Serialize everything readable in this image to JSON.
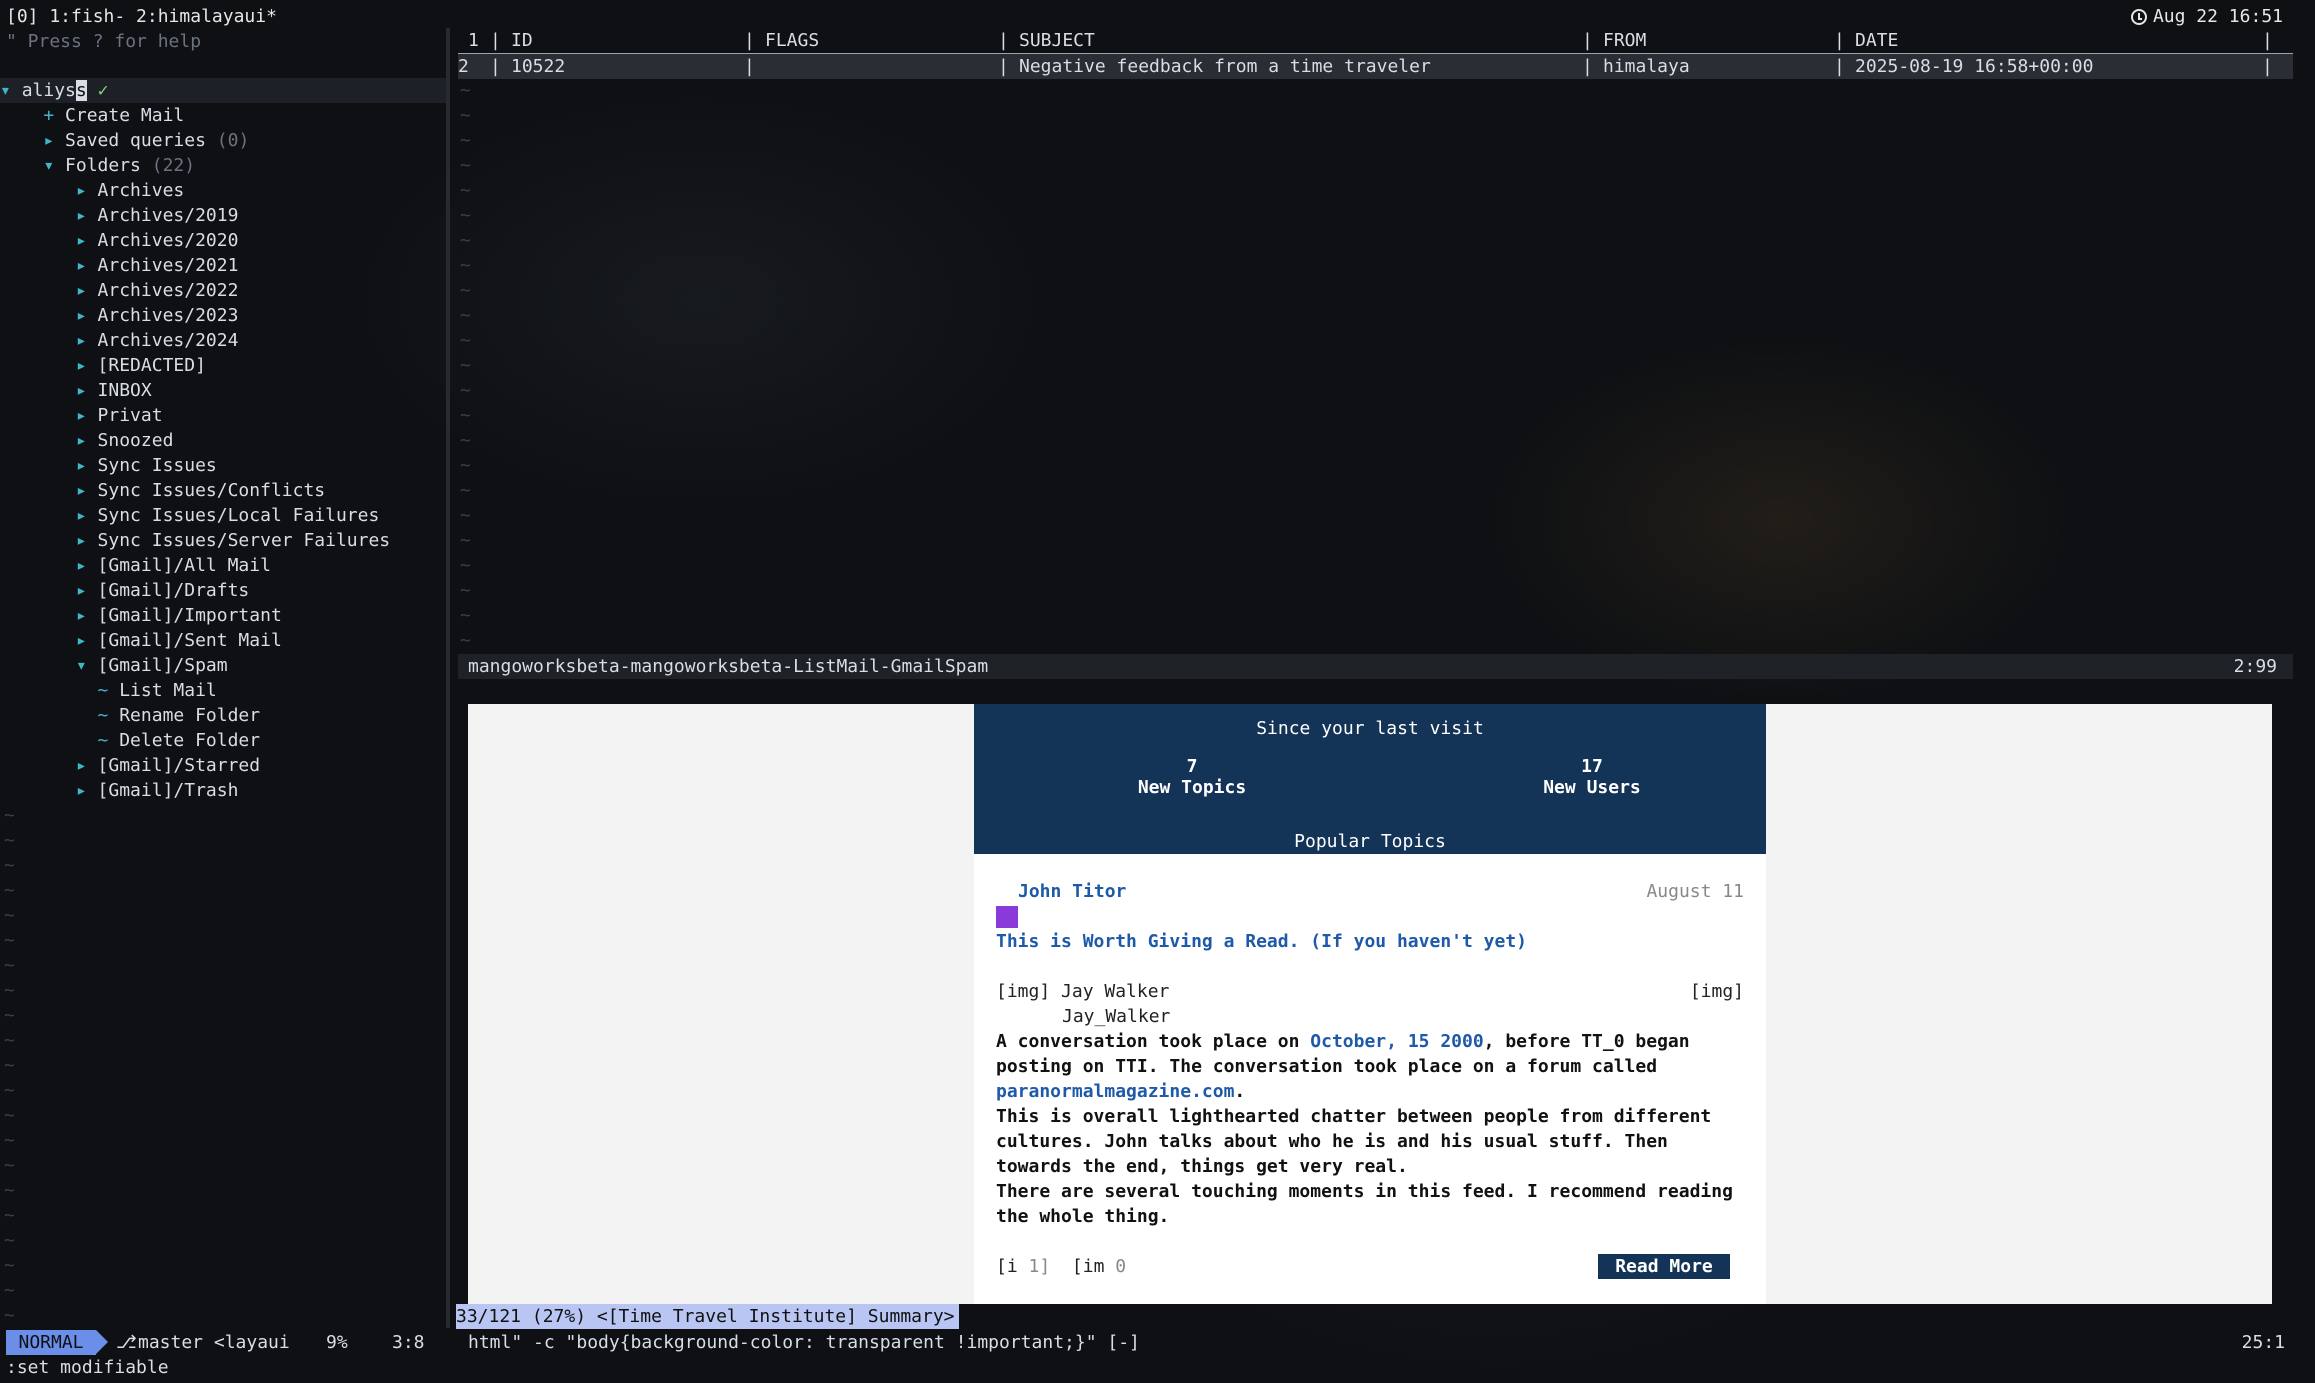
{
  "tmux": {
    "windows": "[0] 1:fish- 2:himalayaui*",
    "clock": "Aug 22 16:51",
    "clock_icon": "clock-icon"
  },
  "help_hint": "\" Press ? for help",
  "tree": {
    "account": "aliyss",
    "account_check": "✓",
    "create_mail": "Create Mail",
    "saved_queries": "Saved queries",
    "saved_queries_count": "(0)",
    "folders": "Folders",
    "folders_count": "(22)",
    "folder_items": [
      "Archives",
      "Archives/2019",
      "Archives/2020",
      "Archives/2021",
      "Archives/2022",
      "Archives/2023",
      "Archives/2024",
      "[REDACTED]",
      "INBOX",
      "Privat",
      "Snoozed",
      "Sync Issues",
      "Sync Issues/Conflicts",
      "Sync Issues/Local Failures",
      "Sync Issues/Server Failures",
      "[Gmail]/All Mail",
      "[Gmail]/Drafts",
      "[Gmail]/Important",
      "[Gmail]/Sent Mail",
      "[Gmail]/Spam"
    ],
    "spam_actions": [
      "List Mail",
      "Rename Folder",
      "Delete Folder"
    ],
    "after_items": [
      "[Gmail]/Starred",
      "[Gmail]/Trash"
    ]
  },
  "mail_list": {
    "header": {
      "line": "1",
      "id": "ID",
      "flags": "FLAGS",
      "subject": "SUBJECT",
      "from": "FROM",
      "date": "DATE"
    },
    "rows": [
      {
        "line": "2",
        "id": "10522",
        "flags": "",
        "subject": "Negative feedback from a time traveler",
        "from": "himalaya",
        "date": "2025-08-19 16:58+00:00"
      }
    ]
  },
  "buffer_bar": {
    "title": "mangoworksbeta-mangoworksbeta-ListMail-GmailSpam",
    "position": "2:99"
  },
  "preview": {
    "hero_title": "Since your last visit",
    "stats": [
      {
        "num": "7",
        "label": "New Topics"
      },
      {
        "num": "17",
        "label": "New Users"
      }
    ],
    "popular": "Popular Topics",
    "author": "John Titor",
    "date": "August 11",
    "post_title": "This is Worth Giving a Read. (If you haven't yet)",
    "img_left": "[img] Jay Walker",
    "img_right": "[img]",
    "username": "Jay_Walker",
    "p1_a": "A conversation took place on ",
    "p1_link": "October, 15 2000",
    "p1_b": ", before TT_0 began",
    "p2": "posting on TTI. The conversation took place on a forum called",
    "p3_link": "paranormalmagazine.com",
    "p3_b": ".",
    "p4": "This is overall lighthearted chatter between people from different",
    "p5": "cultures. John talks about who he is and his usual stuff. Then",
    "p6": "towards the end, things get very real.",
    "p7": "There are several touching moments in this feed. I recommend reading",
    "p8": "the whole thing.",
    "counter_i": "[i",
    "counter_i_val": "1]",
    "counter_im": "[im",
    "counter_im_val": "0",
    "read_more": "Read More"
  },
  "pager_status": "33/121 (27%) <[Time Travel Institute] Summary>",
  "statusline": {
    "mode": "NORMAL",
    "branch_icon": "⎇",
    "branch": "master <layaui",
    "percent": "9%",
    "location": "3:8",
    "cmd": "html\" -c \"body{background-color: transparent !important;}\" [-]",
    "right_pos": "25:1"
  },
  "cmdline": ":set modifiable"
}
